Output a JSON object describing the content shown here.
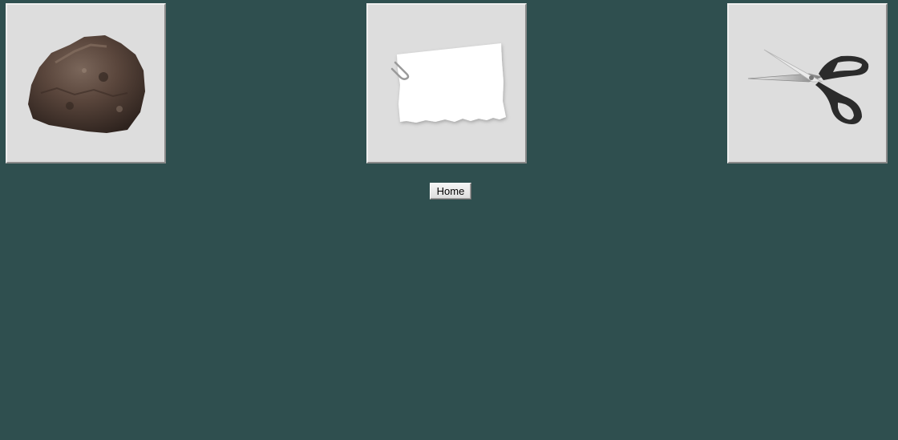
{
  "choices": [
    {
      "name": "rock",
      "icon": "rock-icon"
    },
    {
      "name": "paper",
      "icon": "paper-icon"
    },
    {
      "name": "scissors",
      "icon": "scissors-icon"
    }
  ],
  "controls": {
    "home_label": "Home"
  },
  "colors": {
    "background": "#2f4f4f",
    "tile": "#dddddd"
  }
}
